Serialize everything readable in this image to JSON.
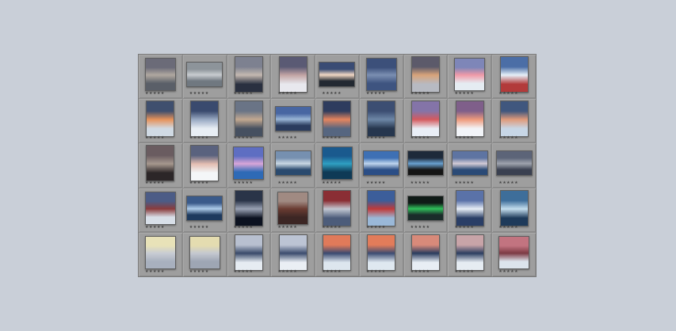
{
  "filmstrip": {
    "rating_glyph": "★★★★★",
    "thumbnails": [
      {
        "orientation": "square",
        "colors": [
          "#6b6b78",
          "#b0a8a0",
          "#5a5f68"
        ]
      },
      {
        "orientation": "landscape",
        "colors": [
          "#8d949a",
          "#c8ccd0",
          "#707880"
        ]
      },
      {
        "orientation": "portrait",
        "colors": [
          "#7d8190",
          "#c4b8b0",
          "#2a3040"
        ]
      },
      {
        "orientation": "portrait",
        "colors": [
          "#5a5a74",
          "#c2a4a4",
          "#e8e8ee"
        ]
      },
      {
        "orientation": "landscape",
        "colors": [
          "#3a4c74",
          "#f2d8c4",
          "#222831"
        ]
      },
      {
        "orientation": "square",
        "colors": [
          "#3c507a",
          "#7b8fb2",
          "#3e5480"
        ]
      },
      {
        "orientation": "portrait",
        "colors": [
          "#5c5a6a",
          "#d8a47a",
          "#b7bac2"
        ]
      },
      {
        "orientation": "square",
        "colors": [
          "#7e86b8",
          "#f09aa8",
          "#e5ecf2"
        ]
      },
      {
        "orientation": "portrait",
        "colors": [
          "#4b6ea6",
          "#e6f0f8",
          "#b23a3a"
        ]
      },
      {
        "orientation": "portrait",
        "colors": [
          "#3f4f6e",
          "#e6925a",
          "#d0dae4"
        ]
      },
      {
        "orientation": "portrait",
        "colors": [
          "#3a4a6e",
          "#98a8c2",
          "#e8eef4"
        ]
      },
      {
        "orientation": "portrait",
        "colors": [
          "#6a7486",
          "#c2a890",
          "#465060"
        ]
      },
      {
        "orientation": "landscape",
        "colors": [
          "#4866a2",
          "#9ab6d6",
          "#2b3c5e"
        ]
      },
      {
        "orientation": "portrait",
        "colors": [
          "#2e3c5e",
          "#e5855e",
          "#566680"
        ]
      },
      {
        "orientation": "portrait",
        "colors": [
          "#3c4e72",
          "#6d86a6",
          "#26364e"
        ]
      },
      {
        "orientation": "portrait",
        "colors": [
          "#8474a8",
          "#d45a5e",
          "#e9eef6"
        ]
      },
      {
        "orientation": "portrait",
        "colors": [
          "#7f5f8a",
          "#ee9a7c",
          "#f2f4f8"
        ]
      },
      {
        "orientation": "portrait",
        "colors": [
          "#40577e",
          "#e09a7a",
          "#c7d6e6"
        ]
      },
      {
        "orientation": "portrait",
        "colors": [
          "#6a5c60",
          "#a6988e",
          "#2c2628"
        ]
      },
      {
        "orientation": "portrait",
        "colors": [
          "#5a627e",
          "#e2bcb0",
          "#f4f6f8"
        ]
      },
      {
        "orientation": "square",
        "colors": [
          "#5e6ec2",
          "#d9a6d8",
          "#2e6ab6"
        ]
      },
      {
        "orientation": "landscape",
        "colors": [
          "#7690b0",
          "#cad8e4",
          "#2a4a6e"
        ]
      },
      {
        "orientation": "square",
        "colors": [
          "#1a5a8e",
          "#2fa0c2",
          "#0f3a56"
        ]
      },
      {
        "orientation": "landscape",
        "colors": [
          "#3e70b4",
          "#c0d6ee",
          "#2b4e86"
        ]
      },
      {
        "orientation": "landscape",
        "colors": [
          "#1e2a3a",
          "#6aa2d2",
          "#151515"
        ]
      },
      {
        "orientation": "landscape",
        "colors": [
          "#5e74a2",
          "#d4ccd6",
          "#2a4a76"
        ]
      },
      {
        "orientation": "landscape",
        "colors": [
          "#5c6478",
          "#9fa4ae",
          "#3a4050"
        ]
      },
      {
        "orientation": "square",
        "colors": [
          "#4c5c86",
          "#8a3c3c",
          "#d8dfe8"
        ]
      },
      {
        "orientation": "landscape",
        "colors": [
          "#3a5a8a",
          "#aeccea",
          "#1e3a5e"
        ]
      },
      {
        "orientation": "portrait",
        "colors": [
          "#2a3448",
          "#9aa2b4",
          "#0c1220"
        ]
      },
      {
        "orientation": "square",
        "colors": [
          "#a08a82",
          "#6a3c32",
          "#3c2624"
        ]
      },
      {
        "orientation": "portrait",
        "colors": [
          "#8a2e34",
          "#c2c8d2",
          "#4c5c7a"
        ]
      },
      {
        "orientation": "portrait",
        "colors": [
          "#3c5e9a",
          "#c03a3a",
          "#9ab8d8"
        ]
      },
      {
        "orientation": "landscape",
        "colors": [
          "#0f1a16",
          "#2fbf5a",
          "#1a2c2a"
        ]
      },
      {
        "orientation": "portrait",
        "colors": [
          "#5a72a8",
          "#e8eef6",
          "#2a3e66"
        ]
      },
      {
        "orientation": "portrait",
        "colors": [
          "#3e6e9a",
          "#c4deee",
          "#1e3a5a"
        ]
      },
      {
        "orientation": "square",
        "colors": [
          "#e8e2b8",
          "#c8ccd4",
          "#a8b0be"
        ]
      },
      {
        "orientation": "square",
        "colors": [
          "#e4dcb0",
          "#c4c8d0",
          "#9ea6b4"
        ]
      },
      {
        "orientation": "portrait",
        "colors": [
          "#b8c0d0",
          "#3a4a6a",
          "#e6ecf2"
        ]
      },
      {
        "orientation": "portrait",
        "colors": [
          "#bcc4d4",
          "#3c4c6e",
          "#eaeff4"
        ]
      },
      {
        "orientation": "portrait",
        "colors": [
          "#e07a5a",
          "#3a4a70",
          "#dde6ee"
        ]
      },
      {
        "orientation": "portrait",
        "colors": [
          "#e27c5a",
          "#3c4c72",
          "#dfe8f0"
        ]
      },
      {
        "orientation": "portrait",
        "colors": [
          "#d88a7a",
          "#2a3c5e",
          "#e8eef4"
        ]
      },
      {
        "orientation": "portrait",
        "colors": [
          "#c8a4a8",
          "#2c3e60",
          "#e6ecf2"
        ]
      },
      {
        "orientation": "square",
        "colors": [
          "#c27480",
          "#7c3a44",
          "#dce4ec"
        ]
      }
    ]
  }
}
